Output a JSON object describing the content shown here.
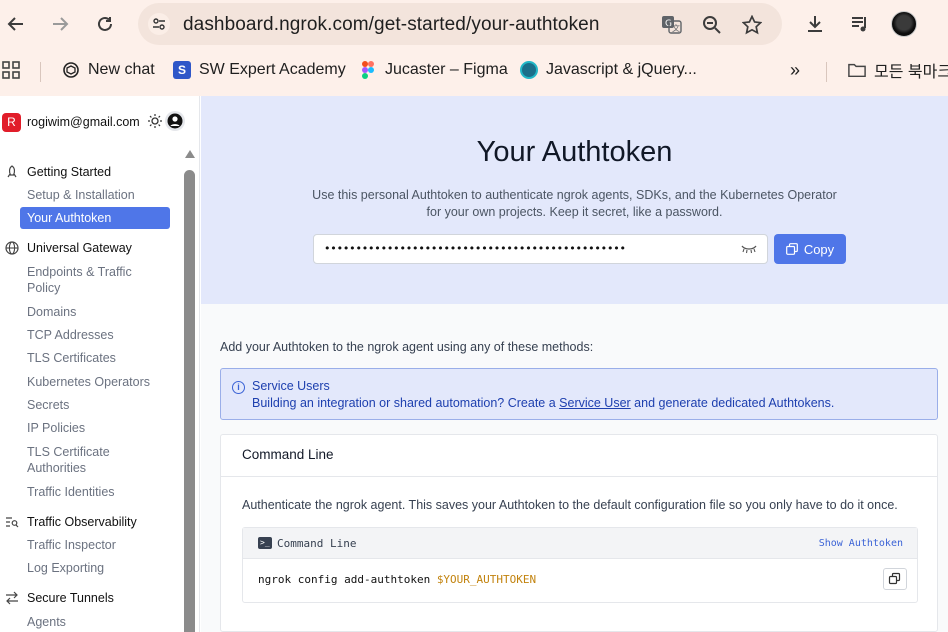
{
  "browser": {
    "url": "dashboard.ngrok.com/get-started/your-authtoken",
    "bookmarks": [
      {
        "label": "New chat",
        "icon": "openai-icon"
      },
      {
        "label": "SW Expert Academy",
        "icon": "swea-icon"
      },
      {
        "label": "Jucaster – Figma",
        "icon": "figma-icon"
      },
      {
        "label": "Javascript & jQuery...",
        "icon": "site-icon"
      }
    ],
    "more": "»",
    "all_bookmarks": "모든 북마크"
  },
  "account": {
    "initial": "R",
    "email": "rogiwim@gmail.com"
  },
  "nav": {
    "sections": [
      {
        "label": "Getting Started",
        "icon": "rocket-icon",
        "items": [
          "Setup & Installation",
          "Your Authtoken"
        ]
      },
      {
        "label": "Universal Gateway",
        "icon": "globe-icon",
        "items": [
          "Endpoints & Traffic Policy",
          "Domains",
          "TCP Addresses",
          "TLS Certificates",
          "Kubernetes Operators",
          "Secrets",
          "IP Policies",
          "TLS Certificate Authorities",
          "Traffic Identities"
        ]
      },
      {
        "label": "Traffic Observability",
        "icon": "list-search-icon",
        "items": [
          "Traffic Inspector",
          "Log Exporting"
        ]
      },
      {
        "label": "Secure Tunnels",
        "icon": "arrows-icon",
        "items": [
          "Agents"
        ]
      }
    ],
    "active_item": "Your Authtoken"
  },
  "hero": {
    "title": "Your Authtoken",
    "subtitle_line1": "Use this personal Authtoken to authenticate ngrok agents, SDKs, and the Kubernetes Operator",
    "subtitle_line2": "for your own projects. Keep it secret, like a password.",
    "token_mask": "••••••••••••••••••••••••••••••••••••••••••••••••",
    "copy_label": "Copy"
  },
  "main": {
    "intro": "Add your Authtoken to the ngrok agent using any of these methods:",
    "info": {
      "title": "Service Users",
      "text_before": "Building an integration or shared automation? Create a ",
      "link": "Service User",
      "text_after": " and generate dedicated Authtokens."
    },
    "card": {
      "title": "Command Line",
      "description": "Authenticate the ngrok agent. This saves your Authtoken to the default configuration file so you only have to do it once.",
      "code_label": "Command Line",
      "show_token": "Show Authtoken",
      "command": "ngrok config add-authtoken ",
      "command_var": "$YOUR_AUTHTOKEN"
    }
  },
  "colors": {
    "accent": "#4f76e8",
    "hero_bg": "#e3e8fb",
    "chrome_bg": "#fdf0ea"
  }
}
